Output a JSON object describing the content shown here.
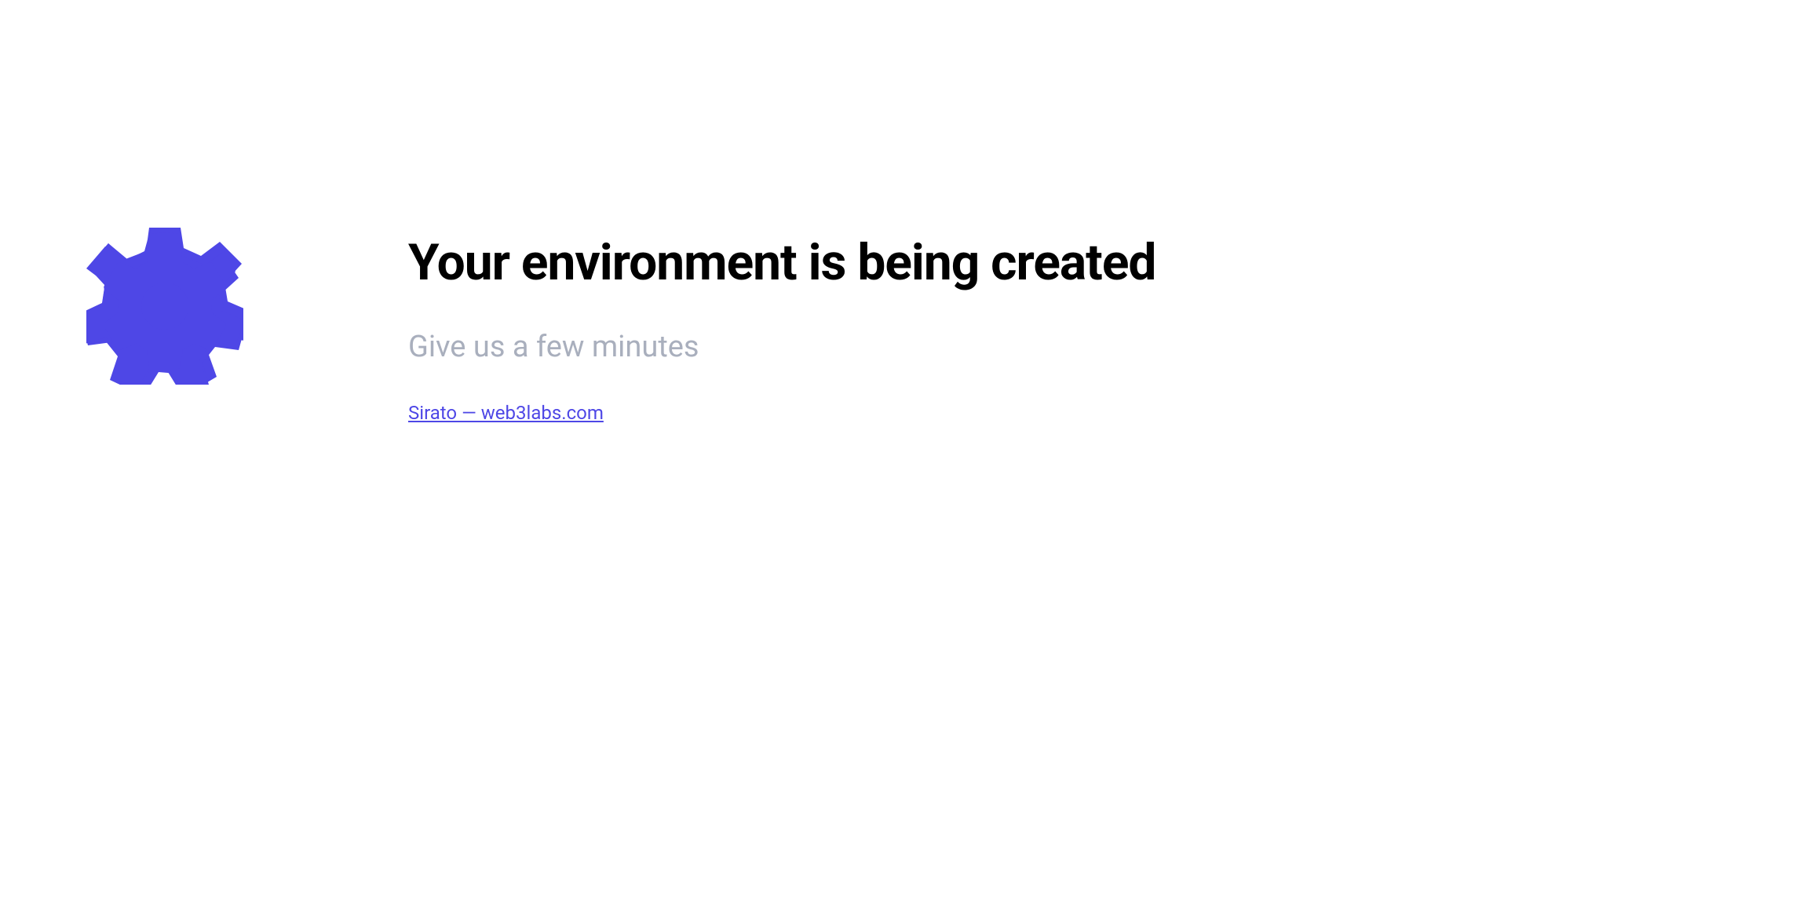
{
  "main": {
    "heading": "Your environment is being created",
    "subtitle": "Give us a few minutes",
    "link_text": "Sirato — web3labs.com"
  },
  "colors": {
    "accent": "#4e47e6",
    "heading": "#000000",
    "subtitle": "#a9afbd"
  },
  "icon": {
    "name": "gear-icon"
  }
}
